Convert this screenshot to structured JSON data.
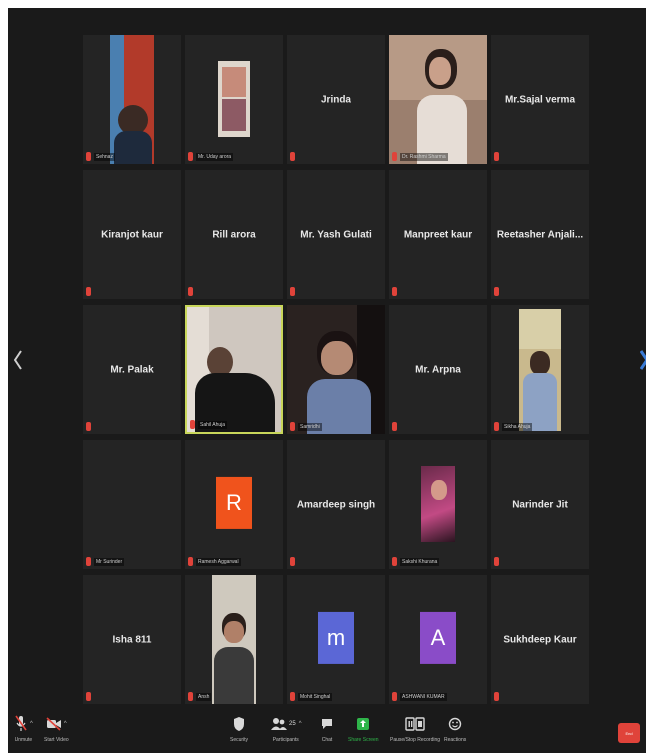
{
  "tiles": [
    {
      "name": "",
      "label": "Sehnaz",
      "kind": "video"
    },
    {
      "name": "",
      "label": "Mr. Uday arora",
      "kind": "photo"
    },
    {
      "name": "Jrinda",
      "label": "",
      "kind": "name"
    },
    {
      "name": "",
      "label": "Dr. Rashmi Sharma",
      "kind": "video"
    },
    {
      "name": "Mr.Sajal verma",
      "label": "",
      "kind": "name"
    },
    {
      "name": "Kiranjot kaur",
      "label": "",
      "kind": "name"
    },
    {
      "name": "Rill arora",
      "label": "",
      "kind": "name"
    },
    {
      "name": "Mr. Yash Gulati",
      "label": "",
      "kind": "name"
    },
    {
      "name": "Manpreet kaur",
      "label": "",
      "kind": "name"
    },
    {
      "name": "Reetasher Anjali...",
      "label": "",
      "kind": "name"
    },
    {
      "name": "Mr. Palak",
      "label": "",
      "kind": "name"
    },
    {
      "name": "",
      "label": "Sahil Ahuja",
      "kind": "video"
    },
    {
      "name": "",
      "label": "Samridhi",
      "kind": "video"
    },
    {
      "name": "Mr. Arpna",
      "label": "",
      "kind": "name"
    },
    {
      "name": "",
      "label": "Sikha Ahuja",
      "kind": "photo"
    },
    {
      "name": "",
      "label": "Mr Surinder",
      "kind": "name"
    },
    {
      "name": "",
      "label": "Ramesh Aggarwal",
      "kind": "avatar",
      "letter": "R"
    },
    {
      "name": "Amardeep singh",
      "label": "",
      "kind": "name"
    },
    {
      "name": "",
      "label": "Sakshi Khurana",
      "kind": "photo"
    },
    {
      "name": "Narinder Jit",
      "label": "",
      "kind": "name"
    },
    {
      "name": "Isha 811",
      "label": "",
      "kind": "name"
    },
    {
      "name": "",
      "label": "Ansh",
      "kind": "video"
    },
    {
      "name": "",
      "label": "Mohit Singhal",
      "kind": "avatar",
      "letter": "m"
    },
    {
      "name": "",
      "label": "ASHWANI KUMAR",
      "kind": "avatar",
      "letter": "A"
    },
    {
      "name": "Sukhdeep Kaur",
      "label": "",
      "kind": "name"
    }
  ],
  "toolbar": {
    "unmute": "Unmute",
    "start_video": "Start Video",
    "security": "Security",
    "participants": "Participants",
    "participants_count": "25",
    "chat": "Chat",
    "share_screen": "Share Screen",
    "record": "Pause/Stop Recording",
    "reactions": "Reactions",
    "end": "End"
  },
  "colors": {
    "background": "#1a1a1a",
    "tile": "#242424",
    "active_border": "#c8d65a",
    "muted": "#e0433a",
    "share_green": "#2fb54a",
    "avatar_r": "#f0531c",
    "avatar_m": "#5b67d6",
    "avatar_a": "#8a4cc8",
    "side_arrow": "#3a7bd5"
  }
}
